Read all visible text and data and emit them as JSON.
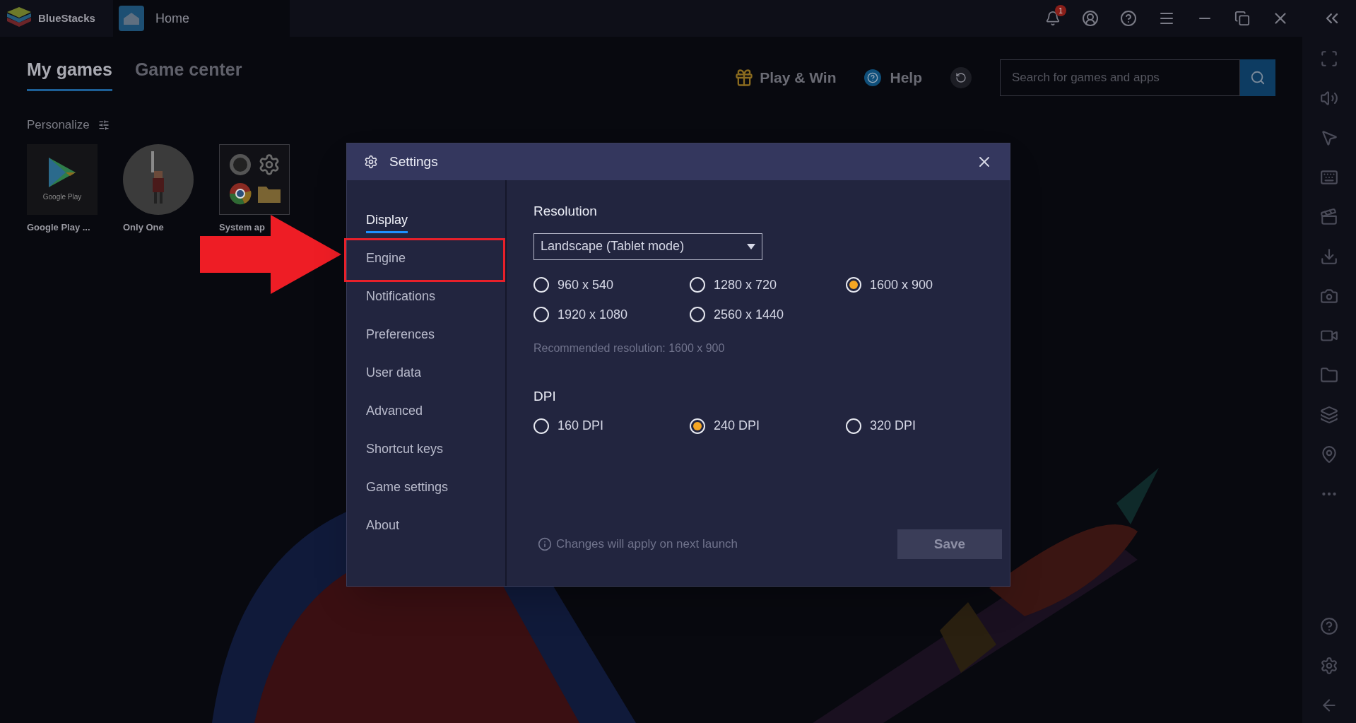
{
  "app": {
    "title": "BlueStacks",
    "tab": "Home",
    "notification_count": "1"
  },
  "nav_tabs": [
    {
      "label": "My games",
      "selected": true
    },
    {
      "label": "Game center",
      "selected": false
    }
  ],
  "actions": {
    "play_win": "Play & Win",
    "help": "Help",
    "search": {
      "placeholder": "Search for games and apps"
    }
  },
  "personalize": "Personalize",
  "games": [
    {
      "kind": "play",
      "name": "Google Play ...",
      "tile_text": "Google Play"
    },
    {
      "kind": "character",
      "name": "Only One"
    },
    {
      "kind": "folder",
      "name": "System ap"
    }
  ],
  "settings": {
    "title": "Settings",
    "menu": [
      {
        "label": "Display",
        "selected": true,
        "highlighted": false
      },
      {
        "label": "Engine",
        "selected": false,
        "highlighted": true
      },
      {
        "label": "Notifications",
        "selected": false,
        "highlighted": false
      },
      {
        "label": "Preferences",
        "selected": false,
        "highlighted": false
      },
      {
        "label": "User data",
        "selected": false,
        "highlighted": false
      },
      {
        "label": "Advanced",
        "selected": false,
        "highlighted": false
      },
      {
        "label": "Shortcut keys",
        "selected": false,
        "highlighted": false
      },
      {
        "label": "Game settings",
        "selected": false,
        "highlighted": false
      },
      {
        "label": "About",
        "selected": false,
        "highlighted": false
      }
    ],
    "resolution": {
      "heading": "Resolution",
      "mode": "Landscape (Tablet mode)",
      "options": [
        {
          "label": "960 x 540",
          "selected": false
        },
        {
          "label": "1280 x 720",
          "selected": false
        },
        {
          "label": "1600 x 900",
          "selected": true
        },
        {
          "label": "1920 x 1080",
          "selected": false
        },
        {
          "label": "2560 x 1440",
          "selected": false
        }
      ],
      "recommended": "Recommended resolution: 1600 x 900"
    },
    "dpi": {
      "heading": "DPI",
      "options": [
        {
          "label": "160 DPI",
          "selected": false
        },
        {
          "label": "240 DPI",
          "selected": true
        },
        {
          "label": "320 DPI",
          "selected": false
        }
      ]
    },
    "note": "Changes will apply on next launch",
    "save": {
      "label": "Save",
      "disabled": true
    }
  }
}
